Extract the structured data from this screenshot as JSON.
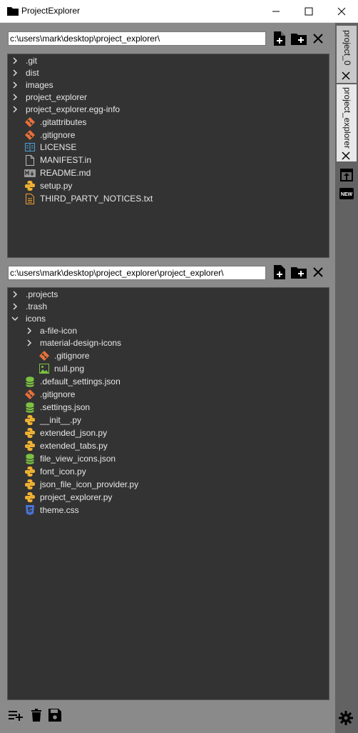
{
  "window": {
    "title": "ProjectExplorer"
  },
  "pane1": {
    "path": "c:\\users\\mark\\desktop\\project_explorer\\",
    "items": [
      {
        "label": ".git",
        "type": "folder"
      },
      {
        "label": "dist",
        "type": "folder"
      },
      {
        "label": "images",
        "type": "folder"
      },
      {
        "label": "project_explorer",
        "type": "folder"
      },
      {
        "label": "project_explorer.egg-info",
        "type": "folder"
      },
      {
        "label": ".gitattributes",
        "icon": "git-icon"
      },
      {
        "label": ".gitignore",
        "icon": "git-icon"
      },
      {
        "label": "LICENSE",
        "icon": "license-icon"
      },
      {
        "label": "MANIFEST.in",
        "icon": "file-icon"
      },
      {
        "label": "README.md",
        "icon": "markdown-icon"
      },
      {
        "label": "setup.py",
        "icon": "python-icon"
      },
      {
        "label": "THIRD_PARTY_NOTICES.txt",
        "icon": "text-file-icon"
      }
    ]
  },
  "pane2": {
    "path": "c:\\users\\mark\\desktop\\project_explorer\\project_explorer\\",
    "items": [
      {
        "label": ".projects",
        "type": "folder"
      },
      {
        "label": ".trash",
        "type": "folder"
      },
      {
        "label": "icons",
        "type": "folder-open"
      },
      {
        "label": "a-file-icon",
        "type": "folder"
      },
      {
        "label": "material-design-icons",
        "type": "folder"
      },
      {
        "label": ".gitignore",
        "icon": "git-icon"
      },
      {
        "label": "null.png",
        "icon": "image-icon"
      },
      {
        "label": ".default_settings.json",
        "icon": "json-icon"
      },
      {
        "label": ".gitignore",
        "icon": "git-icon"
      },
      {
        "label": ".settings.json",
        "icon": "json-icon"
      },
      {
        "label": "__init__.py",
        "icon": "python-icon"
      },
      {
        "label": "extended_json.py",
        "icon": "python-icon"
      },
      {
        "label": "extended_tabs.py",
        "icon": "python-icon"
      },
      {
        "label": "file_view_icons.json",
        "icon": "json-icon"
      },
      {
        "label": "font_icon.py",
        "icon": "python-icon"
      },
      {
        "label": "json_file_icon_provider.py",
        "icon": "python-icon"
      },
      {
        "label": "project_explorer.py",
        "icon": "python-icon"
      },
      {
        "label": "theme.css",
        "icon": "css-icon"
      }
    ]
  },
  "tabs": [
    {
      "label": "project_0"
    },
    {
      "label": "project_explorer"
    }
  ],
  "colors": {
    "git": "#e8703a",
    "python": "#f0b232",
    "json": "#7bc142",
    "css": "#4a72d8",
    "license": "#4ea0d8",
    "text": "#f0a030",
    "image": "#7bc142"
  }
}
